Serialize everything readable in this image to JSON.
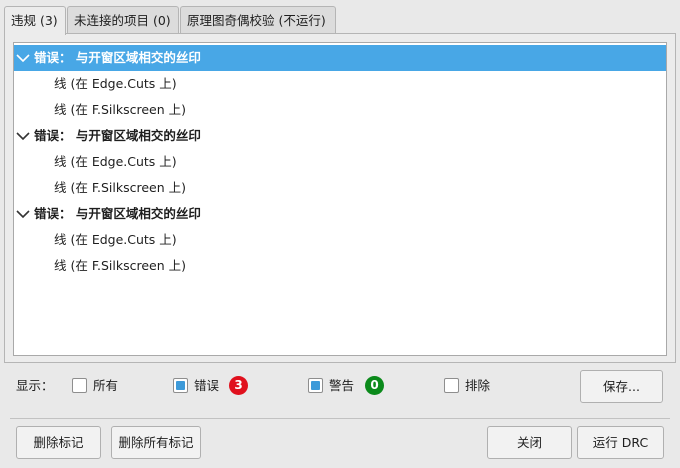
{
  "tabs": [
    {
      "label": "违规 (3)",
      "active": true
    },
    {
      "label": "未连接的项目 (0)",
      "active": false
    },
    {
      "label": "原理图奇偶校验 (不运行)",
      "active": false
    }
  ],
  "violations": [
    {
      "label": "错误：  与开窗区域相交的丝印",
      "selected": true,
      "items": [
        "线 (在 Edge.Cuts 上)",
        "线 (在 F.Silkscreen 上)"
      ]
    },
    {
      "label": "错误：  与开窗区域相交的丝印",
      "selected": false,
      "items": [
        "线 (在 Edge.Cuts 上)",
        "线 (在 F.Silkscreen 上)"
      ]
    },
    {
      "label": "错误：  与开窗区域相交的丝印",
      "selected": false,
      "items": [
        "线 (在 Edge.Cuts 上)",
        "线 (在 F.Silkscreen 上)"
      ]
    }
  ],
  "filters": {
    "show_label": "显示：",
    "all": {
      "label": "所有",
      "checked": false
    },
    "errors": {
      "label": "错误",
      "checked": true,
      "count": "3",
      "color": "#e0101d"
    },
    "warnings": {
      "label": "警告",
      "checked": true,
      "count": "0",
      "color": "#0b8a1b"
    },
    "exclusions": {
      "label": "排除",
      "checked": false
    }
  },
  "buttons": {
    "save": "保存...",
    "delete_marker": "删除标记",
    "delete_all_markers": "删除所有标记",
    "close": "关闭",
    "run_drc": "运行 DRC"
  },
  "colors": {
    "selection": "#48a7e6",
    "checkbox_fill": "#3d9ad9"
  }
}
